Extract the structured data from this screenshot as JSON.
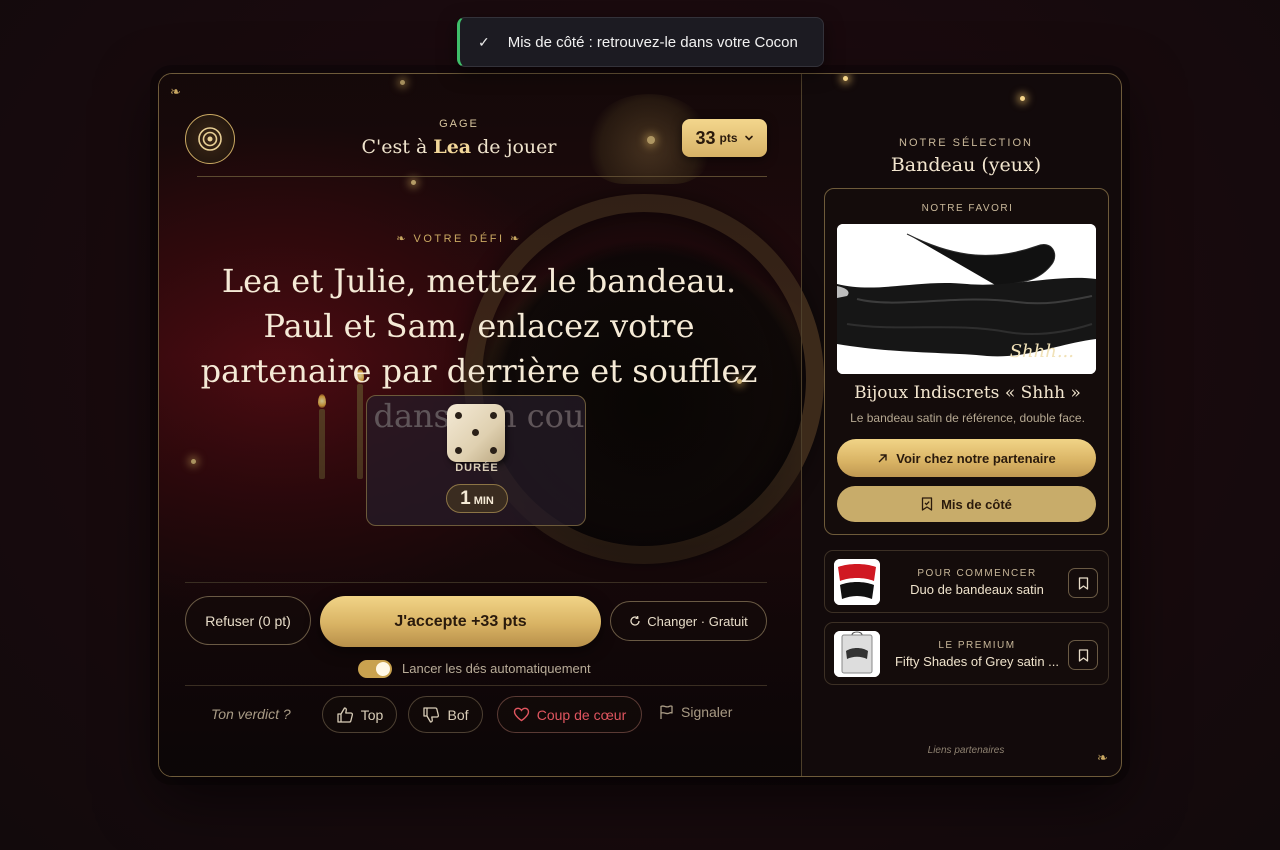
{
  "toast": {
    "check": "✓",
    "message": "Mis de côté : retrouvez-le dans votre Cocon"
  },
  "header": {
    "kicker": "GAGE",
    "turn_prefix": "C'est à",
    "player": "Lea",
    "turn_suffix": "de jouer",
    "points_value": "33",
    "points_unit": "pts"
  },
  "challenge": {
    "kicker": "❧ VOTRE DÉFI ❧",
    "text": "Lea et Julie, mettez le bandeau. Paul et Sam, enlacez votre partenaire par derrière et soufflez dans son cou",
    "duration_label": "DURÉE",
    "duration_value": "1",
    "duration_unit": "MIN"
  },
  "actions": {
    "refuse": "Refuser (0 pt)",
    "accept": "J'accepte +33 pts",
    "change": "Changer · Gratuit",
    "auto_dice_label": "Lancer les dés automatiquement",
    "auto_dice_on": true
  },
  "verdict": {
    "question": "Ton verdict ?",
    "top": "Top",
    "bof": "Bof",
    "coup_de_coeur": "Coup de cœur",
    "report": "Signaler"
  },
  "sidebar": {
    "kicker": "NOTRE SÉLECTION",
    "title": "Bandeau (yeux)",
    "favorite": {
      "kicker": "NOTRE FAVORI",
      "image_script": "Shhh...",
      "name": "Bijoux Indiscrets « Shhh »",
      "description": "Le bandeau satin de référence, double face.",
      "cta": "Voir chez notre partenaire",
      "saved": "Mis de côté"
    },
    "products": [
      {
        "kicker": "POUR COMMENCER",
        "name": "Duo de bandeaux satin"
      },
      {
        "kicker": "LE PREMIUM",
        "name": "Fifty Shades of Grey satin ..."
      }
    ],
    "partners_note": "Liens partenaires"
  },
  "colors": {
    "accent_gold": "#d9b364",
    "toast_success": "#3fbf6a",
    "heart_red": "#e0555f"
  }
}
